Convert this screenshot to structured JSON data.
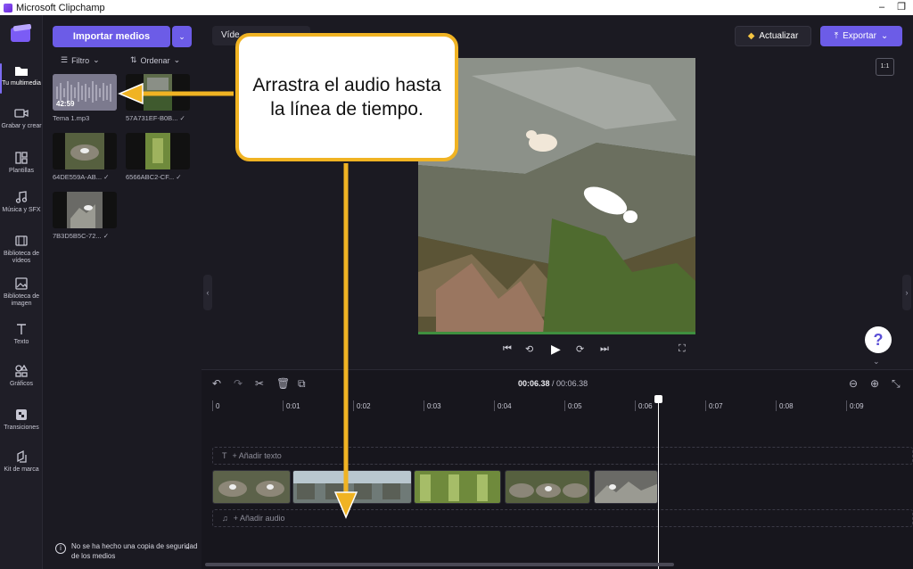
{
  "window": {
    "title": "Microsoft Clipchamp"
  },
  "nav": {
    "items": [
      {
        "label": "Tu multimedia",
        "icon": "folder-icon"
      },
      {
        "label": "Grabar y crear",
        "icon": "camera-icon"
      },
      {
        "label": "Plantillas",
        "icon": "templates-icon"
      },
      {
        "label": "Música y SFX",
        "icon": "music-icon"
      },
      {
        "label": "Biblioteca de vídeos",
        "icon": "film-icon"
      },
      {
        "label": "Biblioteca de imagen",
        "icon": "image-icon"
      },
      {
        "label": "Texto",
        "icon": "text-icon"
      },
      {
        "label": "Gráficos",
        "icon": "shapes-icon"
      },
      {
        "label": "Transiciones",
        "icon": "transitions-icon"
      },
      {
        "label": "Kit de marca",
        "icon": "brand-kit-icon"
      }
    ]
  },
  "media": {
    "import_label": "Importar medios",
    "filter_label": "Filtro",
    "sort_label": "Ordenar",
    "items": [
      {
        "name": "Tema 1.mp3",
        "duration": "42:59",
        "kind": "audio"
      },
      {
        "name": "57A731EF-B0B...",
        "kind": "video"
      },
      {
        "name": "64DE559A-AB...",
        "kind": "video"
      },
      {
        "name": "6566ABC2-CF...",
        "kind": "video"
      },
      {
        "name": "7B3D5B5C-72...",
        "kind": "video"
      }
    ],
    "backup_notice": "No se ha hecho una copia de seguridad de los medios"
  },
  "topbar": {
    "video_tab": "Víde",
    "upgrade_label": "Actualizar",
    "export_label": "Exportar",
    "ratio_label": "1:1"
  },
  "help": {
    "label": "?"
  },
  "timeline": {
    "current": "00:06.38",
    "separator": " / ",
    "total": "00:06.38",
    "ticks": [
      "0",
      "0:01",
      "0:02",
      "0:03",
      "0:04",
      "0:05",
      "0:06",
      "0:07",
      "0:08",
      "0:09"
    ],
    "add_text": "+ Añadir texto",
    "add_audio": "+ Añadir audio"
  },
  "callout": {
    "text": "Arrastra el audio hasta la línea de tiempo."
  },
  "colors": {
    "accent": "#6c5ce7",
    "callout_border": "#f0b323",
    "background": "#1b1a22"
  }
}
